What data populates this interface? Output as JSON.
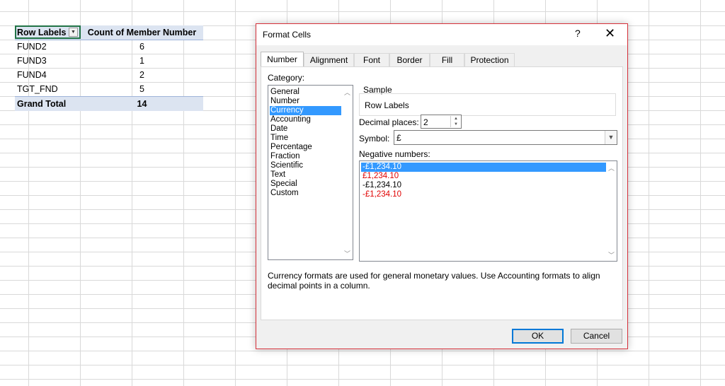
{
  "pivot": {
    "header": {
      "row_labels": "Row Labels",
      "count": "Count of Member Number"
    },
    "rows": [
      {
        "label": "FUND2",
        "value": "6"
      },
      {
        "label": "FUND3",
        "value": "1"
      },
      {
        "label": "FUND4",
        "value": "2"
      },
      {
        "label": "TGT_FND",
        "value": "5"
      }
    ],
    "total": {
      "label": "Grand Total",
      "value": "14"
    }
  },
  "dialog": {
    "title": "Format Cells",
    "help": "?",
    "close": "✕",
    "tabs": [
      "Number",
      "Alignment",
      "Font",
      "Border",
      "Fill",
      "Protection"
    ],
    "category_label": "Category:",
    "categories": [
      "General",
      "Number",
      "Currency",
      "Accounting",
      "Date",
      "Time",
      "Percentage",
      "Fraction",
      "Scientific",
      "Text",
      "Special",
      "Custom"
    ],
    "selected_category": "Currency",
    "sample_label": "Sample",
    "sample_value": "Row Labels",
    "decimal_label": "Decimal places:",
    "decimal_value": "2",
    "symbol_label": "Symbol:",
    "symbol_value": "£",
    "negative_label": "Negative numbers:",
    "negative_options": [
      {
        "text": "-£1,234.10",
        "color": "#000000",
        "selected": true
      },
      {
        "text": "£1,234.10",
        "color": "#e00000",
        "selected": false
      },
      {
        "text": "-£1,234.10",
        "color": "#000000",
        "selected": false
      },
      {
        "text": "-£1,234.10",
        "color": "#e00000",
        "selected": false
      }
    ],
    "description": "Currency formats are used for general monetary values.  Use Accounting formats to align decimal points in a column.",
    "ok": "OK",
    "cancel": "Cancel"
  },
  "colors": {
    "accent": "#0078d7",
    "selection": "#3399ff",
    "pivot_header": "#dce4f1",
    "dialog_border": "#d6303a"
  }
}
